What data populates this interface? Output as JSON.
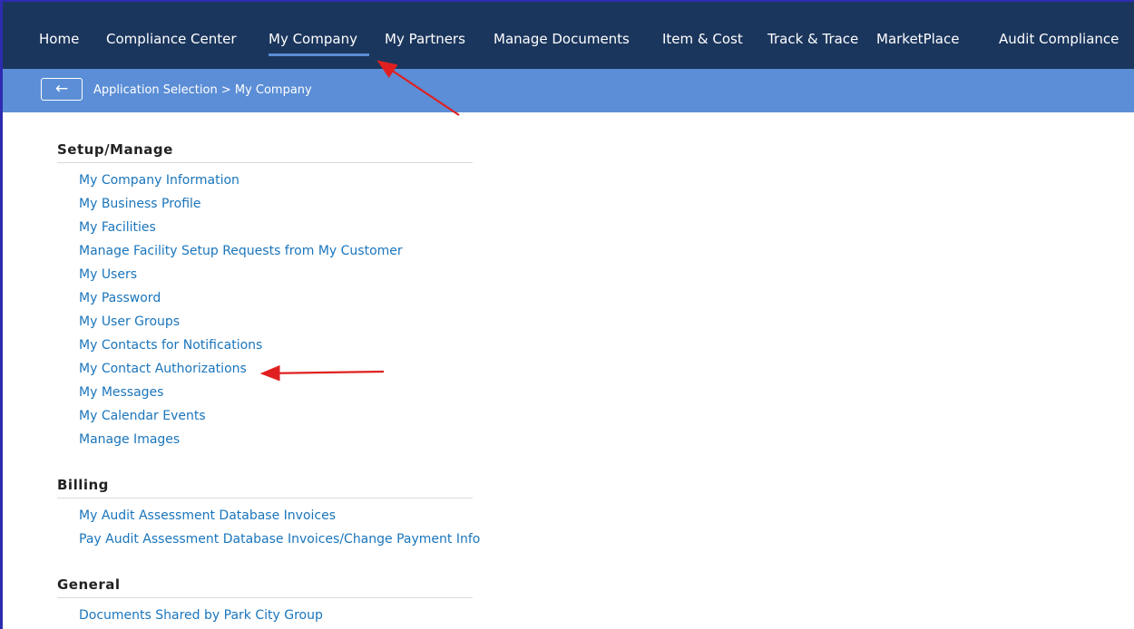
{
  "nav": {
    "items": [
      {
        "label": "Home"
      },
      {
        "label": "Compliance Center"
      },
      {
        "label": "My Company"
      },
      {
        "label": "My Partners"
      },
      {
        "label": "Manage Documents"
      },
      {
        "label": "Item & Cost"
      },
      {
        "label": "Track & Trace"
      },
      {
        "label": "MarketPlace"
      },
      {
        "label": "Audit Compliance"
      }
    ],
    "active": "My Company"
  },
  "breadcrumb": {
    "back_icon": "←",
    "text": "Application Selection > My Company"
  },
  "sections": [
    {
      "title": "Setup/Manage",
      "links": [
        "My Company Information",
        "My Business Profile",
        "My Facilities",
        "Manage Facility Setup Requests from My Customer",
        "My Users",
        "My Password",
        "My User Groups",
        "My Contacts for Notifications",
        "My Contact Authorizations",
        "My Messages",
        "My Calendar Events",
        "Manage Images"
      ]
    },
    {
      "title": "Billing",
      "links": [
        "My Audit Assessment Database Invoices",
        "Pay Audit Assessment Database Invoices/Change Payment Info"
      ]
    },
    {
      "title": "General",
      "links": [
        "Documents Shared by Park City Group"
      ]
    }
  ],
  "colors": {
    "nav_bg": "#1b365d",
    "breadcrumb_bg": "#5b8ed6",
    "link": "#1a75bc",
    "annotation_arrow": "#e02020"
  }
}
